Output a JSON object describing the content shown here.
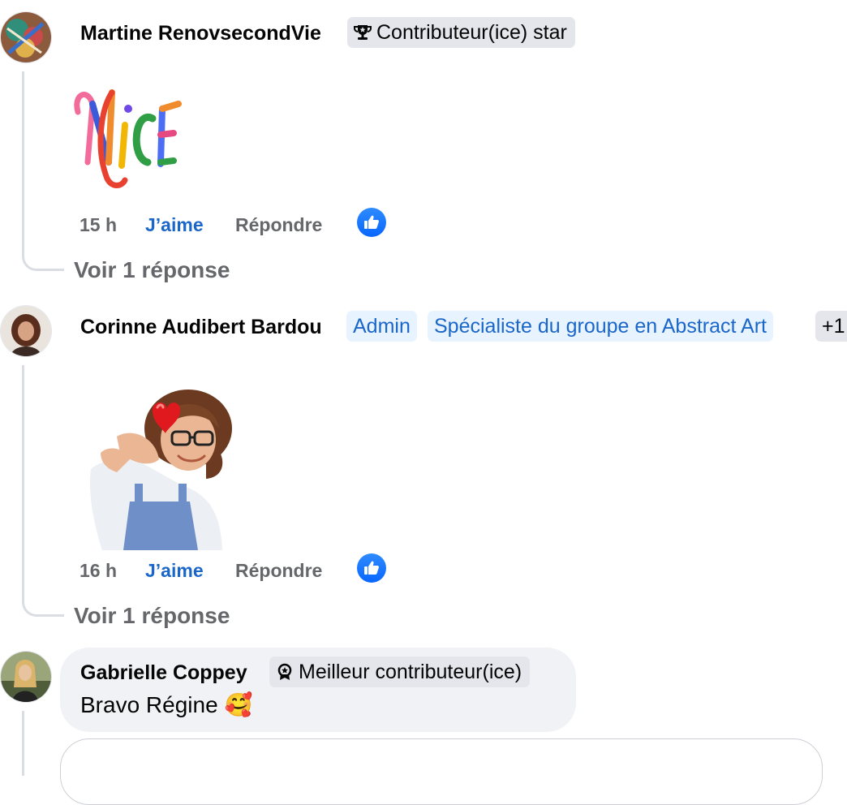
{
  "comments": [
    {
      "author": "Martine RenovsecondVie",
      "badges": [
        {
          "label": "Contributeur(ice) star",
          "icon": "trophy-icon"
        }
      ],
      "sticker": "NICE",
      "time": "15 h",
      "like_label": "J’aime",
      "reply_label": "Répondre",
      "reactions": "like",
      "view_replies": "Voir 1 réponse"
    },
    {
      "author": "Corinne Audibert Bardou",
      "badges": [
        {
          "label": "Admin"
        },
        {
          "label": "Spécialiste du groupe en Abstract Art"
        },
        {
          "label": "+1"
        }
      ],
      "sticker": "avatar-heart-sticker",
      "time": "16 h",
      "like_label": "J’aime",
      "reply_label": "Répondre",
      "reactions": "like",
      "view_replies": "Voir 1 réponse"
    },
    {
      "author": "Gabrielle Coppey",
      "badges": [
        {
          "label": "Meilleur contributeur(ice)",
          "icon": "award-icon"
        }
      ],
      "text": "Bravo Régine",
      "emoji": "🥰"
    }
  ],
  "colors": {
    "link_blue": "#1b66c9",
    "like_blue": "#0866ff",
    "meta_gray": "#65676b",
    "bubble_bg": "#f0f2f5"
  }
}
